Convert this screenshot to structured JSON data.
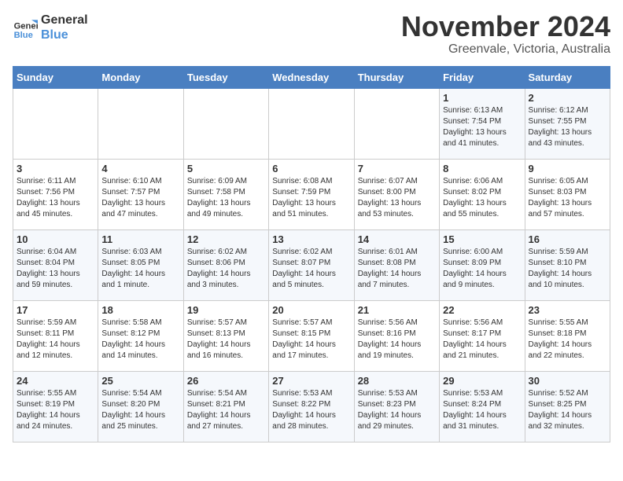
{
  "logo": {
    "line1": "General",
    "line2": "Blue"
  },
  "header": {
    "month": "November 2024",
    "location": "Greenvale, Victoria, Australia"
  },
  "days_of_week": [
    "Sunday",
    "Monday",
    "Tuesday",
    "Wednesday",
    "Thursday",
    "Friday",
    "Saturday"
  ],
  "weeks": [
    [
      {
        "day": "",
        "info": ""
      },
      {
        "day": "",
        "info": ""
      },
      {
        "day": "",
        "info": ""
      },
      {
        "day": "",
        "info": ""
      },
      {
        "day": "",
        "info": ""
      },
      {
        "day": "1",
        "info": "Sunrise: 6:13 AM\nSunset: 7:54 PM\nDaylight: 13 hours\nand 41 minutes."
      },
      {
        "day": "2",
        "info": "Sunrise: 6:12 AM\nSunset: 7:55 PM\nDaylight: 13 hours\nand 43 minutes."
      }
    ],
    [
      {
        "day": "3",
        "info": "Sunrise: 6:11 AM\nSunset: 7:56 PM\nDaylight: 13 hours\nand 45 minutes."
      },
      {
        "day": "4",
        "info": "Sunrise: 6:10 AM\nSunset: 7:57 PM\nDaylight: 13 hours\nand 47 minutes."
      },
      {
        "day": "5",
        "info": "Sunrise: 6:09 AM\nSunset: 7:58 PM\nDaylight: 13 hours\nand 49 minutes."
      },
      {
        "day": "6",
        "info": "Sunrise: 6:08 AM\nSunset: 7:59 PM\nDaylight: 13 hours\nand 51 minutes."
      },
      {
        "day": "7",
        "info": "Sunrise: 6:07 AM\nSunset: 8:00 PM\nDaylight: 13 hours\nand 53 minutes."
      },
      {
        "day": "8",
        "info": "Sunrise: 6:06 AM\nSunset: 8:02 PM\nDaylight: 13 hours\nand 55 minutes."
      },
      {
        "day": "9",
        "info": "Sunrise: 6:05 AM\nSunset: 8:03 PM\nDaylight: 13 hours\nand 57 minutes."
      }
    ],
    [
      {
        "day": "10",
        "info": "Sunrise: 6:04 AM\nSunset: 8:04 PM\nDaylight: 13 hours\nand 59 minutes."
      },
      {
        "day": "11",
        "info": "Sunrise: 6:03 AM\nSunset: 8:05 PM\nDaylight: 14 hours\nand 1 minute."
      },
      {
        "day": "12",
        "info": "Sunrise: 6:02 AM\nSunset: 8:06 PM\nDaylight: 14 hours\nand 3 minutes."
      },
      {
        "day": "13",
        "info": "Sunrise: 6:02 AM\nSunset: 8:07 PM\nDaylight: 14 hours\nand 5 minutes."
      },
      {
        "day": "14",
        "info": "Sunrise: 6:01 AM\nSunset: 8:08 PM\nDaylight: 14 hours\nand 7 minutes."
      },
      {
        "day": "15",
        "info": "Sunrise: 6:00 AM\nSunset: 8:09 PM\nDaylight: 14 hours\nand 9 minutes."
      },
      {
        "day": "16",
        "info": "Sunrise: 5:59 AM\nSunset: 8:10 PM\nDaylight: 14 hours\nand 10 minutes."
      }
    ],
    [
      {
        "day": "17",
        "info": "Sunrise: 5:59 AM\nSunset: 8:11 PM\nDaylight: 14 hours\nand 12 minutes."
      },
      {
        "day": "18",
        "info": "Sunrise: 5:58 AM\nSunset: 8:12 PM\nDaylight: 14 hours\nand 14 minutes."
      },
      {
        "day": "19",
        "info": "Sunrise: 5:57 AM\nSunset: 8:13 PM\nDaylight: 14 hours\nand 16 minutes."
      },
      {
        "day": "20",
        "info": "Sunrise: 5:57 AM\nSunset: 8:15 PM\nDaylight: 14 hours\nand 17 minutes."
      },
      {
        "day": "21",
        "info": "Sunrise: 5:56 AM\nSunset: 8:16 PM\nDaylight: 14 hours\nand 19 minutes."
      },
      {
        "day": "22",
        "info": "Sunrise: 5:56 AM\nSunset: 8:17 PM\nDaylight: 14 hours\nand 21 minutes."
      },
      {
        "day": "23",
        "info": "Sunrise: 5:55 AM\nSunset: 8:18 PM\nDaylight: 14 hours\nand 22 minutes."
      }
    ],
    [
      {
        "day": "24",
        "info": "Sunrise: 5:55 AM\nSunset: 8:19 PM\nDaylight: 14 hours\nand 24 minutes."
      },
      {
        "day": "25",
        "info": "Sunrise: 5:54 AM\nSunset: 8:20 PM\nDaylight: 14 hours\nand 25 minutes."
      },
      {
        "day": "26",
        "info": "Sunrise: 5:54 AM\nSunset: 8:21 PM\nDaylight: 14 hours\nand 27 minutes."
      },
      {
        "day": "27",
        "info": "Sunrise: 5:53 AM\nSunset: 8:22 PM\nDaylight: 14 hours\nand 28 minutes."
      },
      {
        "day": "28",
        "info": "Sunrise: 5:53 AM\nSunset: 8:23 PM\nDaylight: 14 hours\nand 29 minutes."
      },
      {
        "day": "29",
        "info": "Sunrise: 5:53 AM\nSunset: 8:24 PM\nDaylight: 14 hours\nand 31 minutes."
      },
      {
        "day": "30",
        "info": "Sunrise: 5:52 AM\nSunset: 8:25 PM\nDaylight: 14 hours\nand 32 minutes."
      }
    ]
  ]
}
